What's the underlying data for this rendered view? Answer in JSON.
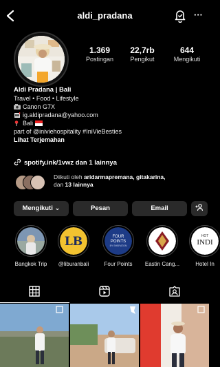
{
  "header": {
    "username": "aldi_pradana",
    "more_label": "···",
    "icons": [
      "back-arrow-icon",
      "notification-bell-icon",
      "more-icon"
    ]
  },
  "stats": {
    "posts": {
      "value": "1.369",
      "label": "Postingan"
    },
    "followers": {
      "value": "22,7rb",
      "label": "Pengikut"
    },
    "following": {
      "value": "644",
      "label": "Mengikuti"
    }
  },
  "bio": {
    "name": "Aldi Pradana | Bali",
    "lines": [
      "Travel • Food • Lifestyle",
      "Canon G7X",
      "ig.aldipradana@yahoo.com",
      "Bali",
      "part of @iniviehospitality #IniVieBesties"
    ],
    "translate": "Lihat Terjemahan"
  },
  "link": {
    "text": "spotify.ink/1vwz dan 1 lainnya"
  },
  "followed_by": {
    "prefix": "Diikuti oleh ",
    "names": "aridarmapremana, gitakarina,",
    "suffix_pre": "dan ",
    "count": "13 lainnya"
  },
  "buttons": {
    "follow": "Mengikuti ⌄",
    "message": "Pesan",
    "email": "Email",
    "add_user": "+²"
  },
  "highlights": [
    {
      "label": "Bangkok Trip"
    },
    {
      "label": "@liburanbali"
    },
    {
      "label": "Four Points"
    },
    {
      "label": "Eastin Cang..."
    },
    {
      "label": "Hotel In"
    }
  ],
  "highlight_text": {
    "lb": "LB",
    "fp_line1": "FOUR",
    "fp_line2": "POINTS",
    "fp_line3": "BY SHERATON",
    "hotel": "HOT",
    "indi": "INDI"
  },
  "tabs": [
    {
      "name": "grid-icon",
      "active": true
    },
    {
      "name": "reels-icon",
      "active": false
    },
    {
      "name": "tagged-icon",
      "active": false
    }
  ],
  "colors": {
    "background": "#000000",
    "button": "#2a2a2a",
    "lb_yellow": "#f2c230",
    "fp_blue": "#1d3b86"
  }
}
